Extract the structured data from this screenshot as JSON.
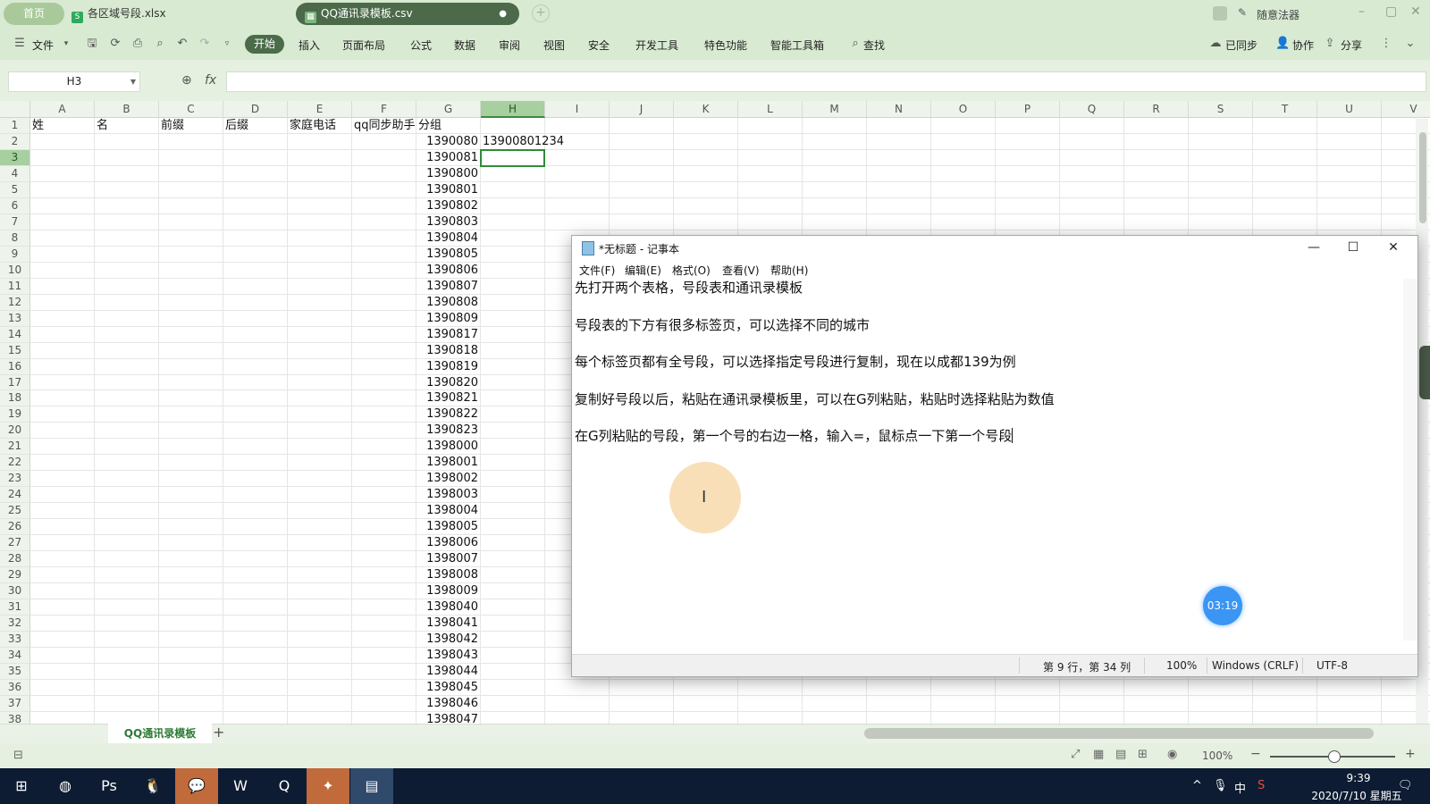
{
  "tabbar": {
    "home": "首页",
    "tabs": [
      {
        "label": "各区域号段.xlsx"
      },
      {
        "label": "QQ通讯录模板.csv"
      }
    ],
    "user": "随意法器"
  },
  "menu": {
    "file": "文件",
    "items": [
      "开始",
      "插入",
      "页面布局",
      "公式",
      "数据",
      "审阅",
      "视图",
      "安全",
      "开发工具",
      "特色功能",
      "智能工具箱",
      "查找"
    ],
    "right": [
      "已同步",
      "协作",
      "分享"
    ]
  },
  "formula_bar": {
    "cell_ref": "H3",
    "fx": "fx",
    "value": ""
  },
  "sheet": {
    "columns": [
      "A",
      "B",
      "C",
      "D",
      "E",
      "F",
      "G",
      "H",
      "I",
      "J",
      "K",
      "L",
      "M",
      "N",
      "O",
      "P",
      "Q",
      "R",
      "S",
      "T",
      "U",
      "V"
    ],
    "selected_column": "H",
    "selected_row": 3,
    "header_row": [
      "姓",
      "名",
      "前缀",
      "后缀",
      "家庭电话",
      "qq同步助手",
      "分组"
    ],
    "g_column": [
      "1390080",
      "1390081",
      "1390800",
      "1390801",
      "1390802",
      "1390803",
      "1390804",
      "1390805",
      "1390806",
      "1390807",
      "1390808",
      "1390809",
      "1390817",
      "1390818",
      "1390819",
      "1390820",
      "1390821",
      "1390822",
      "1390823",
      "1398000",
      "1398001",
      "1398002",
      "1398003",
      "1398004",
      "1398005",
      "1398006",
      "1398007",
      "1398008",
      "1398009",
      "1398040",
      "1398041",
      "1398042",
      "1398043",
      "1398044",
      "1398045",
      "1398046",
      "1398047"
    ],
    "h2": "13900801234",
    "tab_name": "QQ通讯录模板"
  },
  "status": {
    "zoom": "100%"
  },
  "notepad": {
    "title": "*无标题 - 记事本",
    "menus": [
      "文件(F)",
      "编辑(E)",
      "格式(O)",
      "查看(V)",
      "帮助(H)"
    ],
    "lines": [
      "先打开两个表格，号段表和通讯录模板",
      "",
      "号段表的下方有很多标签页，可以选择不同的城市",
      "",
      "每个标签页都有全号段，可以选择指定号段进行复制，现在以成都139为例",
      "",
      "复制好号段以后，粘贴在通讯录模板里，可以在G列粘贴，粘贴时选择粘贴为数值",
      "",
      "在G列粘贴的号段，第一个号的右边一格，输入=，鼠标点一下第一个号段"
    ],
    "status_pos": "第 9 行，第 34 列",
    "status_zoom": "100%",
    "status_eol": "Windows (CRLF)",
    "status_enc": "UTF-8"
  },
  "overlay": {
    "timer": "03:19"
  },
  "taskbar": {
    "time": "9:39",
    "date": "2020/7/10 星期五",
    "ime": "中"
  },
  "colors": {
    "accent": "#4b6b49",
    "selection": "#2f8a3b",
    "taskbar": "#0d1b33"
  }
}
